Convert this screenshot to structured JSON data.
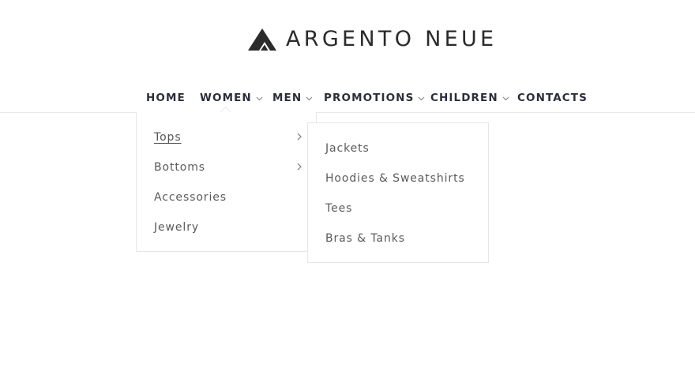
{
  "brand": {
    "name": "ARGENTO NEUE",
    "logo_icon": "triangle-mountain-logo"
  },
  "nav": {
    "items": [
      {
        "label": "HOME",
        "has_dropdown": false
      },
      {
        "label": "WOMEN",
        "has_dropdown": true
      },
      {
        "label": "MEN",
        "has_dropdown": true
      },
      {
        "label": "PROMOTIONS",
        "has_dropdown": true
      },
      {
        "label": "CHILDREN",
        "has_dropdown": true
      },
      {
        "label": "CONTACTS",
        "has_dropdown": false
      }
    ],
    "open_item": "WOMEN"
  },
  "women_menu": {
    "items": [
      {
        "label": "Tops",
        "has_submenu": true,
        "active": true
      },
      {
        "label": "Bottoms",
        "has_submenu": true,
        "active": false
      },
      {
        "label": "Accessories",
        "has_submenu": false,
        "active": false
      },
      {
        "label": "Jewelry",
        "has_submenu": false,
        "active": false
      }
    ]
  },
  "tops_submenu": {
    "items": [
      {
        "label": "Jackets"
      },
      {
        "label": "Hoodies & Sweatshirts"
      },
      {
        "label": "Tees"
      },
      {
        "label": "Bras & Tanks"
      }
    ]
  },
  "colors": {
    "text_dark": "#2c2f3a",
    "text_menu": "#5a5a5a",
    "border": "#e6e6e6",
    "logo": "#2b2b2b"
  }
}
